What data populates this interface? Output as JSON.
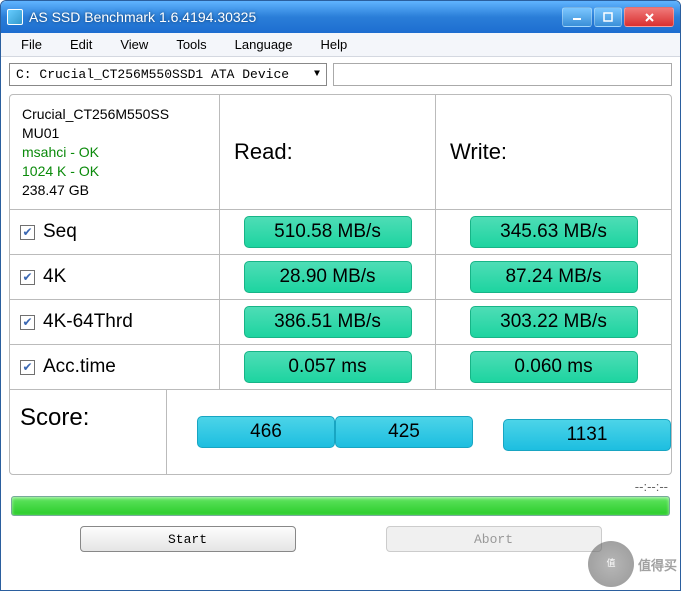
{
  "window": {
    "title": "AS SSD Benchmark 1.6.4194.30325"
  },
  "menu": {
    "file": "File",
    "edit": "Edit",
    "view": "View",
    "tools": "Tools",
    "language": "Language",
    "help": "Help"
  },
  "drive_select": "C: Crucial_CT256M550SSD1 ATA Device",
  "info": {
    "device": "Crucial_CT256M550SS",
    "firmware": "MU01",
    "driver": "msahci - OK",
    "align": "1024 K - OK",
    "size": "238.47 GB"
  },
  "headers": {
    "read": "Read:",
    "write": "Write:"
  },
  "tests": {
    "seq": {
      "label": "Seq",
      "read": "510.58 MB/s",
      "write": "345.63 MB/s"
    },
    "k4": {
      "label": "4K",
      "read": "28.90 MB/s",
      "write": "87.24 MB/s"
    },
    "k464": {
      "label": "4K-64Thrd",
      "read": "386.51 MB/s",
      "write": "303.22 MB/s"
    },
    "acc": {
      "label": "Acc.time",
      "read": "0.057 ms",
      "write": "0.060 ms"
    }
  },
  "score": {
    "label": "Score:",
    "read": "466",
    "write": "425",
    "total": "1131"
  },
  "timer": "--:--:--",
  "buttons": {
    "start": "Start",
    "abort": "Abort"
  },
  "watermark": "值得买"
}
